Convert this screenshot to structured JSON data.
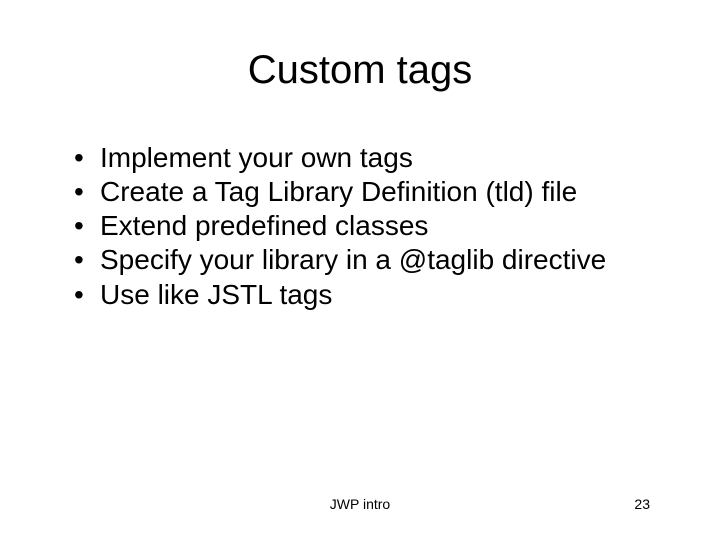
{
  "title": "Custom tags",
  "bullets": [
    "Implement your own tags",
    "Create a Tag Library Definition (tld) file",
    "Extend predefined classes",
    "Specify your library in a @taglib directive",
    "Use like JSTL tags"
  ],
  "footer": {
    "center": "JWP intro",
    "right": "23"
  }
}
